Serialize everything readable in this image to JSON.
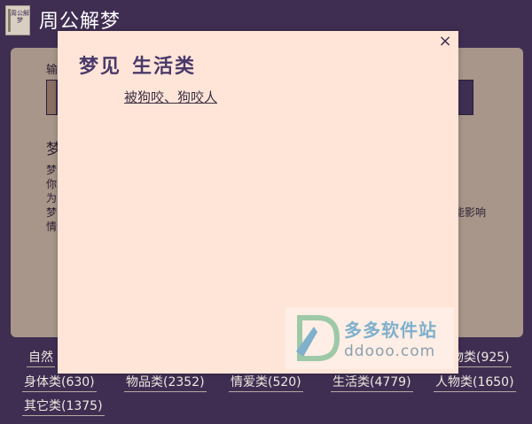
{
  "app": {
    "title": "周公解梦",
    "logo_text": "周公解梦"
  },
  "background": {
    "input_label": "输",
    "heading": "梦",
    "lines": [
      "梦",
      "你",
      "为",
      "梦",
      "情"
    ],
    "right_text": "能影响"
  },
  "categories": [
    {
      "label": "自然"
    },
    {
      "label": "物类(925)"
    },
    {
      "label": "身体类(630)"
    },
    {
      "label": "物品类(2352)"
    },
    {
      "label": "情爱类(520)"
    },
    {
      "label": "生活类(4779)"
    },
    {
      "label": "人物类(1650)"
    },
    {
      "label": "其它类(1375)"
    }
  ],
  "modal": {
    "title_prefix": "梦见",
    "title_category": "生活类",
    "close_symbol": "×",
    "links": [
      "被狗咬、狗咬人"
    ]
  },
  "watermark": {
    "cn": "多多软件站",
    "en": "ddooo.com"
  },
  "colors": {
    "bg": "#3f2e52",
    "panel": "#a8968a",
    "modal": "#ffe5d8",
    "accent": "#4a3a6a"
  }
}
